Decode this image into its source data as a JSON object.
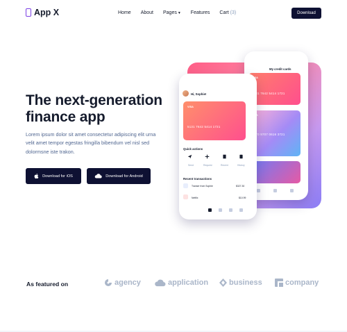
{
  "nav": {
    "logo_text": "App X",
    "menu": [
      "Home",
      "About",
      "Pages",
      "Features",
      "Cart"
    ],
    "cart_count": "(3)",
    "download_label": "Download"
  },
  "hero": {
    "title": "The next-generation finance app",
    "text": "Lorem ipsum dolor sit amet consectetur adipiscing elit urna velit amet tempor egestas fringilla bibendum vel nisl sed dolormsne iste trakon.",
    "ios_label": "Download for iOS",
    "android_label": "Download for Android"
  },
  "phone_back": {
    "title": "My credit cards",
    "card1": {
      "brand": "VISA",
      "number": "5131 7642 5414 1721"
    },
    "card2": {
      "brand": "VISA",
      "number": "4870 9707 0616 3721"
    }
  },
  "phone_front": {
    "greeting": "Hi, Sophie!",
    "card": {
      "brand": "VISA",
      "number": "5131 7642 5414 1721"
    },
    "quick_actions_title": "Quick actions",
    "quick_actions": [
      "Send",
      "Request",
      "Recent",
      "History"
    ],
    "recent_title": "Recent transactions",
    "transactions": [
      {
        "name": "Transer from Sophie",
        "amount": "$327.30"
      },
      {
        "name": "Netflix",
        "amount": "$10.99"
      }
    ]
  },
  "featured": {
    "label": "As featured on",
    "brands": [
      "agency",
      "application",
      "business",
      "company"
    ]
  },
  "colors": {
    "dark": "#0e1133",
    "text": "#161c2d",
    "muted": "#506690",
    "brand_gray": "#aab6c9",
    "accent": "#7b3fe4"
  }
}
